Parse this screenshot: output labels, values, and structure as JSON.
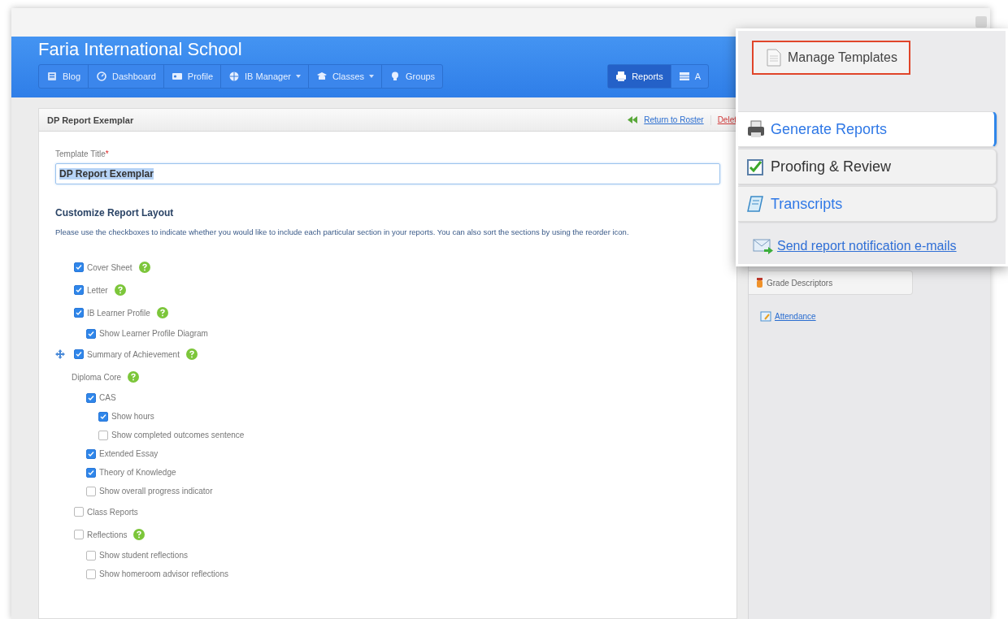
{
  "header": {
    "school_name": "Faria International School",
    "nav": [
      {
        "label": "Blog",
        "dropdown": false
      },
      {
        "label": "Dashboard",
        "dropdown": false
      },
      {
        "label": "Profile",
        "dropdown": false
      },
      {
        "label": "IB Manager",
        "dropdown": true
      },
      {
        "label": "Classes",
        "dropdown": true
      },
      {
        "label": "Groups",
        "dropdown": false
      }
    ],
    "nav_right": [
      {
        "label": "Reports",
        "selected": true
      },
      {
        "label": "A",
        "selected": false
      }
    ]
  },
  "card": {
    "title": "DP Report Exemplar",
    "actions": [
      {
        "label": "Return to Roster",
        "kind": "back"
      },
      {
        "label": "Delet",
        "kind": "danger"
      }
    ],
    "field": {
      "label": "Template Title",
      "required_mark": "*",
      "value": "DP Report Exemplar",
      "value_selected": true
    },
    "layout": {
      "heading": "Customize Report Layout",
      "description": "Please use the checkboxes to indicate whether you would like to include each particular section in your reports. You can also sort the sections by using the reorder icon.",
      "sections": [
        {
          "kind": "checkbox",
          "label": "Cover Sheet",
          "checked": true,
          "help": true,
          "reorder": false
        },
        {
          "kind": "checkbox",
          "label": "Letter",
          "checked": true,
          "help": true,
          "reorder": false
        },
        {
          "kind": "checkbox",
          "label": "IB Learner Profile",
          "checked": true,
          "help": true,
          "reorder": false,
          "children": [
            {
              "kind": "checkbox",
              "label": "Show Learner Profile Diagram",
              "checked": true,
              "help": false,
              "reorder": false
            }
          ]
        },
        {
          "kind": "checkbox",
          "label": "Summary of Achievement",
          "checked": true,
          "help": true,
          "reorder": true
        },
        {
          "kind": "heading",
          "label": "Diploma Core",
          "help": true,
          "reorder": false,
          "children": [
            {
              "kind": "checkbox",
              "label": "CAS",
              "checked": true,
              "help": false,
              "reorder": false,
              "children": [
                {
                  "kind": "checkbox",
                  "label": "Show hours",
                  "checked": true,
                  "help": false,
                  "reorder": false
                },
                {
                  "kind": "checkbox",
                  "label": "Show completed outcomes sentence",
                  "checked": false,
                  "help": false,
                  "reorder": false
                }
              ]
            },
            {
              "kind": "checkbox",
              "label": "Extended Essay",
              "checked": true,
              "help": false,
              "reorder": false
            },
            {
              "kind": "checkbox",
              "label": "Theory of Knowledge",
              "checked": true,
              "help": false,
              "reorder": false
            },
            {
              "kind": "checkbox",
              "label": "Show overall progress indicator",
              "checked": false,
              "help": false,
              "reorder": false
            }
          ]
        },
        {
          "kind": "checkbox",
          "label": "Class Reports",
          "checked": false,
          "help": false,
          "reorder": false
        },
        {
          "kind": "checkbox",
          "label": "Reflections",
          "checked": false,
          "help": true,
          "reorder": false,
          "children": [
            {
              "kind": "checkbox",
              "label": "Show student reflections",
              "checked": false,
              "help": false,
              "reorder": false
            },
            {
              "kind": "checkbox",
              "label": "Show homeroom advisor reflections",
              "checked": false,
              "help": false,
              "reorder": false
            }
          ]
        }
      ]
    }
  },
  "sidebar": {
    "tabs": [
      {
        "label": "Grade Descriptors"
      }
    ],
    "links": [
      {
        "label": "Attendance"
      }
    ]
  },
  "menu": {
    "manage_button": {
      "label": "Manage Templates",
      "highlighted": true
    },
    "items": [
      {
        "label": "Generate Reports",
        "selected": true
      },
      {
        "label": "Proofing & Review",
        "selected": false
      },
      {
        "label": "Transcripts",
        "selected": false
      }
    ],
    "link": {
      "label": "Send report notification e-mails"
    }
  }
}
